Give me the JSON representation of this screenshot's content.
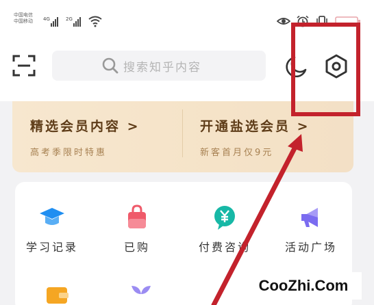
{
  "status_bar": {
    "carrier_1": "中国电信",
    "carrier_2": "中国移动",
    "network_1": "4G",
    "network_2": "2G"
  },
  "search": {
    "placeholder": "搜索知乎内容"
  },
  "member": {
    "left_title": "精选会员内容 >",
    "left_sub": "高考季限时特惠",
    "right_title": "开通盐选会员 >",
    "right_sub": "新客首月仅9元"
  },
  "services": [
    {
      "label": "学习记录",
      "icon": "graduation-cap-icon",
      "color": "#1f8ef1"
    },
    {
      "label": "已购",
      "icon": "shopping-bag-icon",
      "color": "#ef5a6a"
    },
    {
      "label": "付费咨询",
      "icon": "paid-consult-icon",
      "color": "#17b8a6"
    },
    {
      "label": "活动广场",
      "icon": "megaphone-icon",
      "color": "#7b6cf0"
    }
  ],
  "annotation_color": "#c3222c",
  "watermark": "CooZhi.Com"
}
